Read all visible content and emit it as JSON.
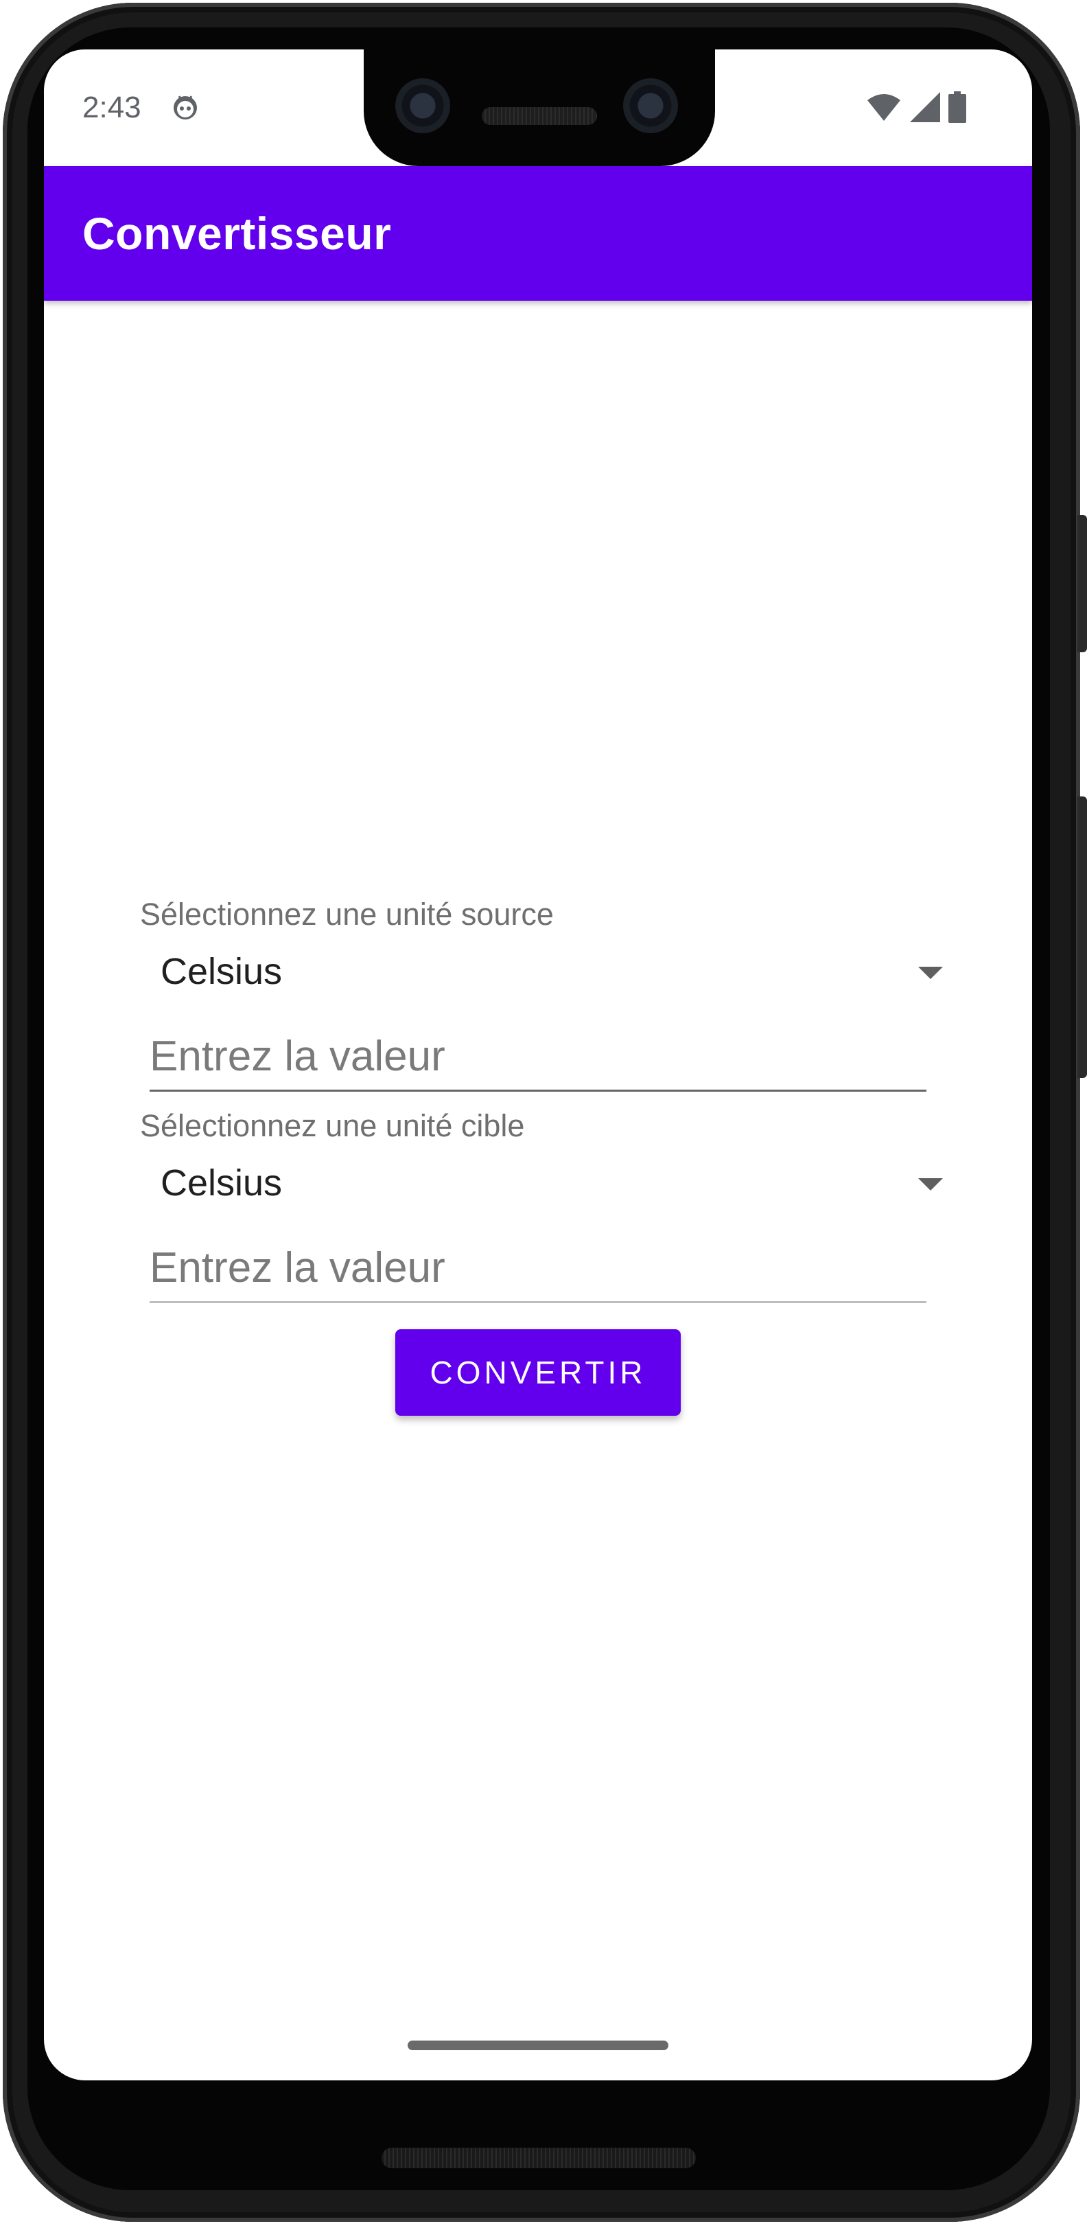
{
  "status_bar": {
    "time": "2:43",
    "icons": [
      "android-debug-icon",
      "wifi-icon",
      "cell-signal-icon",
      "battery-icon"
    ]
  },
  "app_bar": {
    "title": "Convertisseur",
    "color": "#6200ee"
  },
  "form": {
    "source_label": "Sélectionnez une unité source",
    "source_selected": "Celsius",
    "source_input_placeholder": "Entrez la valeur",
    "target_label": "Sélectionnez une unité cible",
    "target_selected": "Celsius",
    "target_input_placeholder": "Entrez la valeur",
    "convert_label": "CONVERTIR"
  },
  "colors": {
    "primary": "#6200ee",
    "on_primary": "#ffffff"
  }
}
